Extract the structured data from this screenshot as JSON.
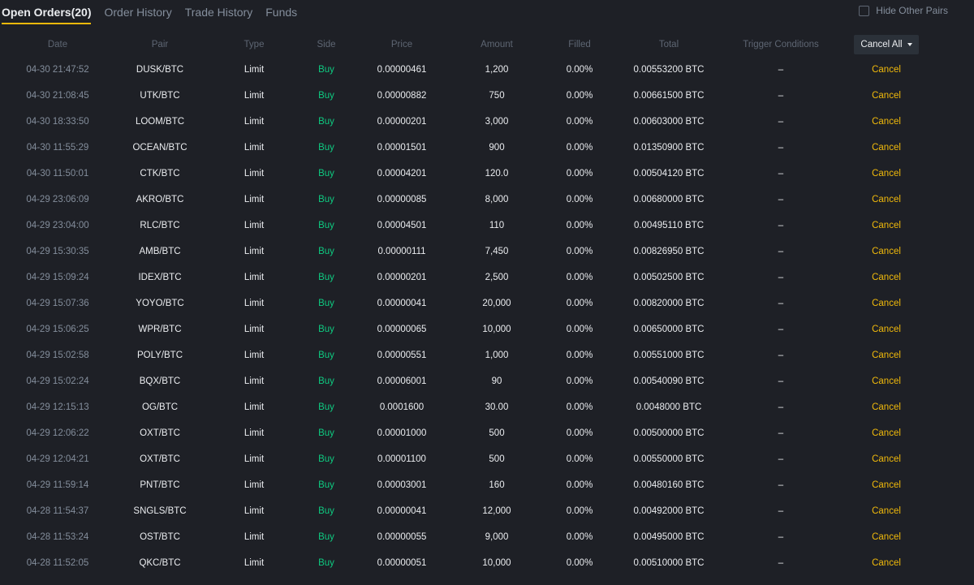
{
  "tabs": [
    {
      "label": "Open Orders(20)"
    },
    {
      "label": "Order History"
    },
    {
      "label": "Trade History"
    },
    {
      "label": "Funds"
    }
  ],
  "hide_other_pairs": {
    "label": "Hide Other Pairs",
    "checked": false
  },
  "columns": {
    "date": "Date",
    "pair": "Pair",
    "type": "Type",
    "side": "Side",
    "price": "Price",
    "amount": "Amount",
    "filled": "Filled",
    "total": "Total",
    "trigger": "Trigger Conditions"
  },
  "cancel_all_label": "Cancel All",
  "colors": {
    "accent": "#f0b90b",
    "buy": "#0ecb81",
    "background": "#1e2026"
  },
  "orders": [
    {
      "date": "04-30 21:47:52",
      "pair": "DUSK/BTC",
      "type": "Limit",
      "side": "Buy",
      "price": "0.00000461",
      "amount": "1,200",
      "filled": "0.00%",
      "total": "0.00553200 BTC",
      "trigger": "–",
      "action": "Cancel"
    },
    {
      "date": "04-30 21:08:45",
      "pair": "UTK/BTC",
      "type": "Limit",
      "side": "Buy",
      "price": "0.00000882",
      "amount": "750",
      "filled": "0.00%",
      "total": "0.00661500 BTC",
      "trigger": "–",
      "action": "Cancel"
    },
    {
      "date": "04-30 18:33:50",
      "pair": "LOOM/BTC",
      "type": "Limit",
      "side": "Buy",
      "price": "0.00000201",
      "amount": "3,000",
      "filled": "0.00%",
      "total": "0.00603000 BTC",
      "trigger": "–",
      "action": "Cancel"
    },
    {
      "date": "04-30 11:55:29",
      "pair": "OCEAN/BTC",
      "type": "Limit",
      "side": "Buy",
      "price": "0.00001501",
      "amount": "900",
      "filled": "0.00%",
      "total": "0.01350900 BTC",
      "trigger": "–",
      "action": "Cancel"
    },
    {
      "date": "04-30 11:50:01",
      "pair": "CTK/BTC",
      "type": "Limit",
      "side": "Buy",
      "price": "0.00004201",
      "amount": "120.0",
      "filled": "0.00%",
      "total": "0.00504120 BTC",
      "trigger": "–",
      "action": "Cancel"
    },
    {
      "date": "04-29 23:06:09",
      "pair": "AKRO/BTC",
      "type": "Limit",
      "side": "Buy",
      "price": "0.00000085",
      "amount": "8,000",
      "filled": "0.00%",
      "total": "0.00680000 BTC",
      "trigger": "–",
      "action": "Cancel"
    },
    {
      "date": "04-29 23:04:00",
      "pair": "RLC/BTC",
      "type": "Limit",
      "side": "Buy",
      "price": "0.00004501",
      "amount": "110",
      "filled": "0.00%",
      "total": "0.00495110 BTC",
      "trigger": "–",
      "action": "Cancel"
    },
    {
      "date": "04-29 15:30:35",
      "pair": "AMB/BTC",
      "type": "Limit",
      "side": "Buy",
      "price": "0.00000111",
      "amount": "7,450",
      "filled": "0.00%",
      "total": "0.00826950 BTC",
      "trigger": "–",
      "action": "Cancel"
    },
    {
      "date": "04-29 15:09:24",
      "pair": "IDEX/BTC",
      "type": "Limit",
      "side": "Buy",
      "price": "0.00000201",
      "amount": "2,500",
      "filled": "0.00%",
      "total": "0.00502500 BTC",
      "trigger": "–",
      "action": "Cancel"
    },
    {
      "date": "04-29 15:07:36",
      "pair": "YOYO/BTC",
      "type": "Limit",
      "side": "Buy",
      "price": "0.00000041",
      "amount": "20,000",
      "filled": "0.00%",
      "total": "0.00820000 BTC",
      "trigger": "–",
      "action": "Cancel"
    },
    {
      "date": "04-29 15:06:25",
      "pair": "WPR/BTC",
      "type": "Limit",
      "side": "Buy",
      "price": "0.00000065",
      "amount": "10,000",
      "filled": "0.00%",
      "total": "0.00650000 BTC",
      "trigger": "–",
      "action": "Cancel"
    },
    {
      "date": "04-29 15:02:58",
      "pair": "POLY/BTC",
      "type": "Limit",
      "side": "Buy",
      "price": "0.00000551",
      "amount": "1,000",
      "filled": "0.00%",
      "total": "0.00551000 BTC",
      "trigger": "–",
      "action": "Cancel"
    },
    {
      "date": "04-29 15:02:24",
      "pair": "BQX/BTC",
      "type": "Limit",
      "side": "Buy",
      "price": "0.00006001",
      "amount": "90",
      "filled": "0.00%",
      "total": "0.00540090 BTC",
      "trigger": "–",
      "action": "Cancel"
    },
    {
      "date": "04-29 12:15:13",
      "pair": "OG/BTC",
      "type": "Limit",
      "side": "Buy",
      "price": "0.0001600",
      "amount": "30.00",
      "filled": "0.00%",
      "total": "0.0048000 BTC",
      "trigger": "–",
      "action": "Cancel"
    },
    {
      "date": "04-29 12:06:22",
      "pair": "OXT/BTC",
      "type": "Limit",
      "side": "Buy",
      "price": "0.00001000",
      "amount": "500",
      "filled": "0.00%",
      "total": "0.00500000 BTC",
      "trigger": "–",
      "action": "Cancel"
    },
    {
      "date": "04-29 12:04:21",
      "pair": "OXT/BTC",
      "type": "Limit",
      "side": "Buy",
      "price": "0.00001100",
      "amount": "500",
      "filled": "0.00%",
      "total": "0.00550000 BTC",
      "trigger": "–",
      "action": "Cancel"
    },
    {
      "date": "04-29 11:59:14",
      "pair": "PNT/BTC",
      "type": "Limit",
      "side": "Buy",
      "price": "0.00003001",
      "amount": "160",
      "filled": "0.00%",
      "total": "0.00480160 BTC",
      "trigger": "–",
      "action": "Cancel"
    },
    {
      "date": "04-28 11:54:37",
      "pair": "SNGLS/BTC",
      "type": "Limit",
      "side": "Buy",
      "price": "0.00000041",
      "amount": "12,000",
      "filled": "0.00%",
      "total": "0.00492000 BTC",
      "trigger": "–",
      "action": "Cancel"
    },
    {
      "date": "04-28 11:53:24",
      "pair": "OST/BTC",
      "type": "Limit",
      "side": "Buy",
      "price": "0.00000055",
      "amount": "9,000",
      "filled": "0.00%",
      "total": "0.00495000 BTC",
      "trigger": "–",
      "action": "Cancel"
    },
    {
      "date": "04-28 11:52:05",
      "pair": "QKC/BTC",
      "type": "Limit",
      "side": "Buy",
      "price": "0.00000051",
      "amount": "10,000",
      "filled": "0.00%",
      "total": "0.00510000 BTC",
      "trigger": "–",
      "action": "Cancel"
    }
  ]
}
